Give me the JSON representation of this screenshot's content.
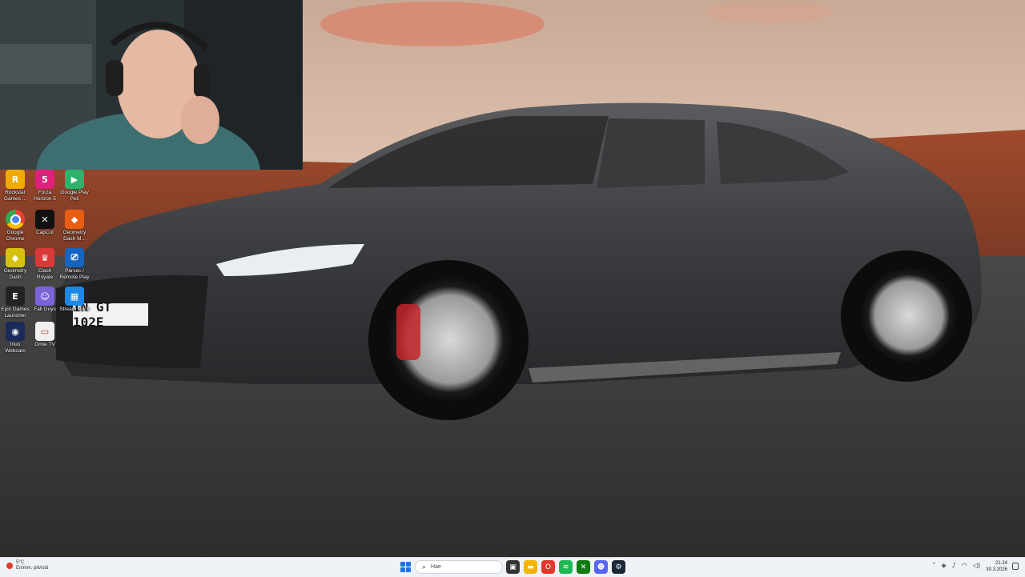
{
  "desktop": {
    "icons": [
      {
        "label": "Rockstar Games ...",
        "icon": "rockstar-icon",
        "color": "#f2a900",
        "glyph": "R"
      },
      {
        "label": "Forza Horizon 5",
        "icon": "forza-icon",
        "color": "#e0207a",
        "glyph": "5"
      },
      {
        "label": "Google Play Peli",
        "icon": "google-play-icon",
        "color": "#2fb36b",
        "glyph": "▶"
      },
      {
        "label": "Google Chrome",
        "icon": "chrome-icon",
        "color": "#ffffff",
        "glyph": ""
      },
      {
        "label": "CapCut",
        "icon": "capcut-icon",
        "color": "#111111",
        "glyph": "✕"
      },
      {
        "label": "Geometry Dash M...",
        "icon": "geometry-dash-meltdown-icon",
        "color": "#e85d10",
        "glyph": "◆"
      },
      {
        "label": "Geometry Dash",
        "icon": "geometry-dash-icon",
        "color": "#d6c10e",
        "glyph": "◆"
      },
      {
        "label": "Clash Royale",
        "icon": "clash-royale-icon",
        "color": "#d83a3a",
        "glyph": "♛"
      },
      {
        "label": "Parsec / Remote Play",
        "icon": "remote-play-icon",
        "color": "#1565c0",
        "glyph": "⎚"
      },
      {
        "label": "Epic Games Launcher",
        "icon": "epic-games-icon",
        "color": "#222222",
        "glyph": "E"
      },
      {
        "label": "Fall Guys",
        "icon": "fall-guys-icon",
        "color": "#7a64d8",
        "glyph": "☺"
      },
      {
        "label": "Stream Dock",
        "icon": "stream-dock-icon",
        "color": "#1e88e5",
        "glyph": "▦"
      },
      {
        "label": "Iriun Webcam",
        "icon": "iriun-webcam-icon",
        "color": "#1b2b59",
        "glyph": "◉"
      },
      {
        "label": "Omie TV",
        "icon": "omie-tv-icon",
        "color": "#f0f0f0",
        "glyph": "▭"
      }
    ]
  },
  "car": {
    "plate": "IN GT 102E"
  },
  "taskbar": {
    "weather_temp": "5°C",
    "weather_desc": "Enimm. pilvistä",
    "search_placeholder": "Hae",
    "apps": [
      {
        "icon": "task-view-icon",
        "color": "#333333",
        "glyph": "▣"
      },
      {
        "icon": "file-explorer-icon",
        "color": "#f4b400",
        "glyph": "▬"
      },
      {
        "icon": "opera-gx-icon",
        "color": "#e0392b",
        "glyph": "O"
      },
      {
        "icon": "spotify-icon",
        "color": "#1db954",
        "glyph": "≋"
      },
      {
        "icon": "xbox-icon",
        "color": "#107c10",
        "glyph": "✕"
      },
      {
        "icon": "discord-icon",
        "color": "#5865f2",
        "glyph": "☻"
      },
      {
        "icon": "steam-icon",
        "color": "#1b2838",
        "glyph": "⚙"
      }
    ],
    "time": "21.24",
    "date": "30.3.2026"
  }
}
